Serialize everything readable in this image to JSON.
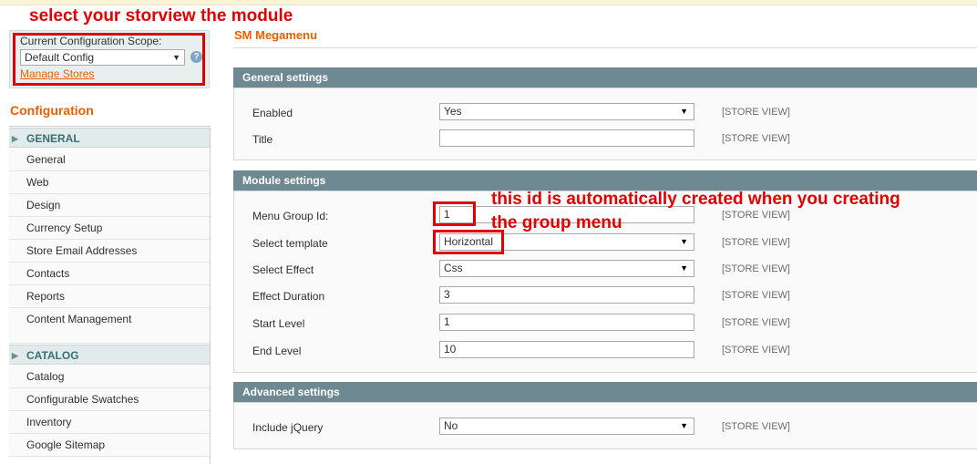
{
  "annotations": {
    "top": "select your storview the module",
    "right_line1": "this id is automatically created when you creating",
    "right_line2": "the group menu"
  },
  "scope": {
    "label": "Current Configuration Scope:",
    "value": "Default Config",
    "manage_link": "Manage Stores"
  },
  "sidebar": {
    "title": "Configuration",
    "sections": [
      {
        "label": "GENERAL",
        "items": [
          "General",
          "Web",
          "Design",
          "Currency Setup",
          "Store Email Addresses",
          "Contacts",
          "Reports",
          "Content Management"
        ]
      },
      {
        "label": "CATALOG",
        "items": [
          "Catalog",
          "Configurable Swatches",
          "Inventory",
          "Google Sitemap"
        ]
      }
    ]
  },
  "main": {
    "title": "SM Megamenu",
    "store_view_tag": "[STORE VIEW]",
    "general": {
      "heading": "General settings",
      "enabled_label": "Enabled",
      "enabled_value": "Yes",
      "title_label": "Title",
      "title_value": ""
    },
    "module": {
      "heading": "Module settings",
      "menu_group_label": "Menu Group Id:",
      "menu_group_value": "1",
      "template_label": "Select template",
      "template_value": "Horizontal",
      "effect_label": "Select Effect",
      "effect_value": "Css",
      "duration_label": "Effect Duration",
      "duration_value": "3",
      "start_label": "Start Level",
      "start_value": "1",
      "end_label": "End Level",
      "end_value": "10"
    },
    "advanced": {
      "heading": "Advanced settings",
      "jquery_label": "Include jQuery",
      "jquery_value": "No"
    }
  }
}
